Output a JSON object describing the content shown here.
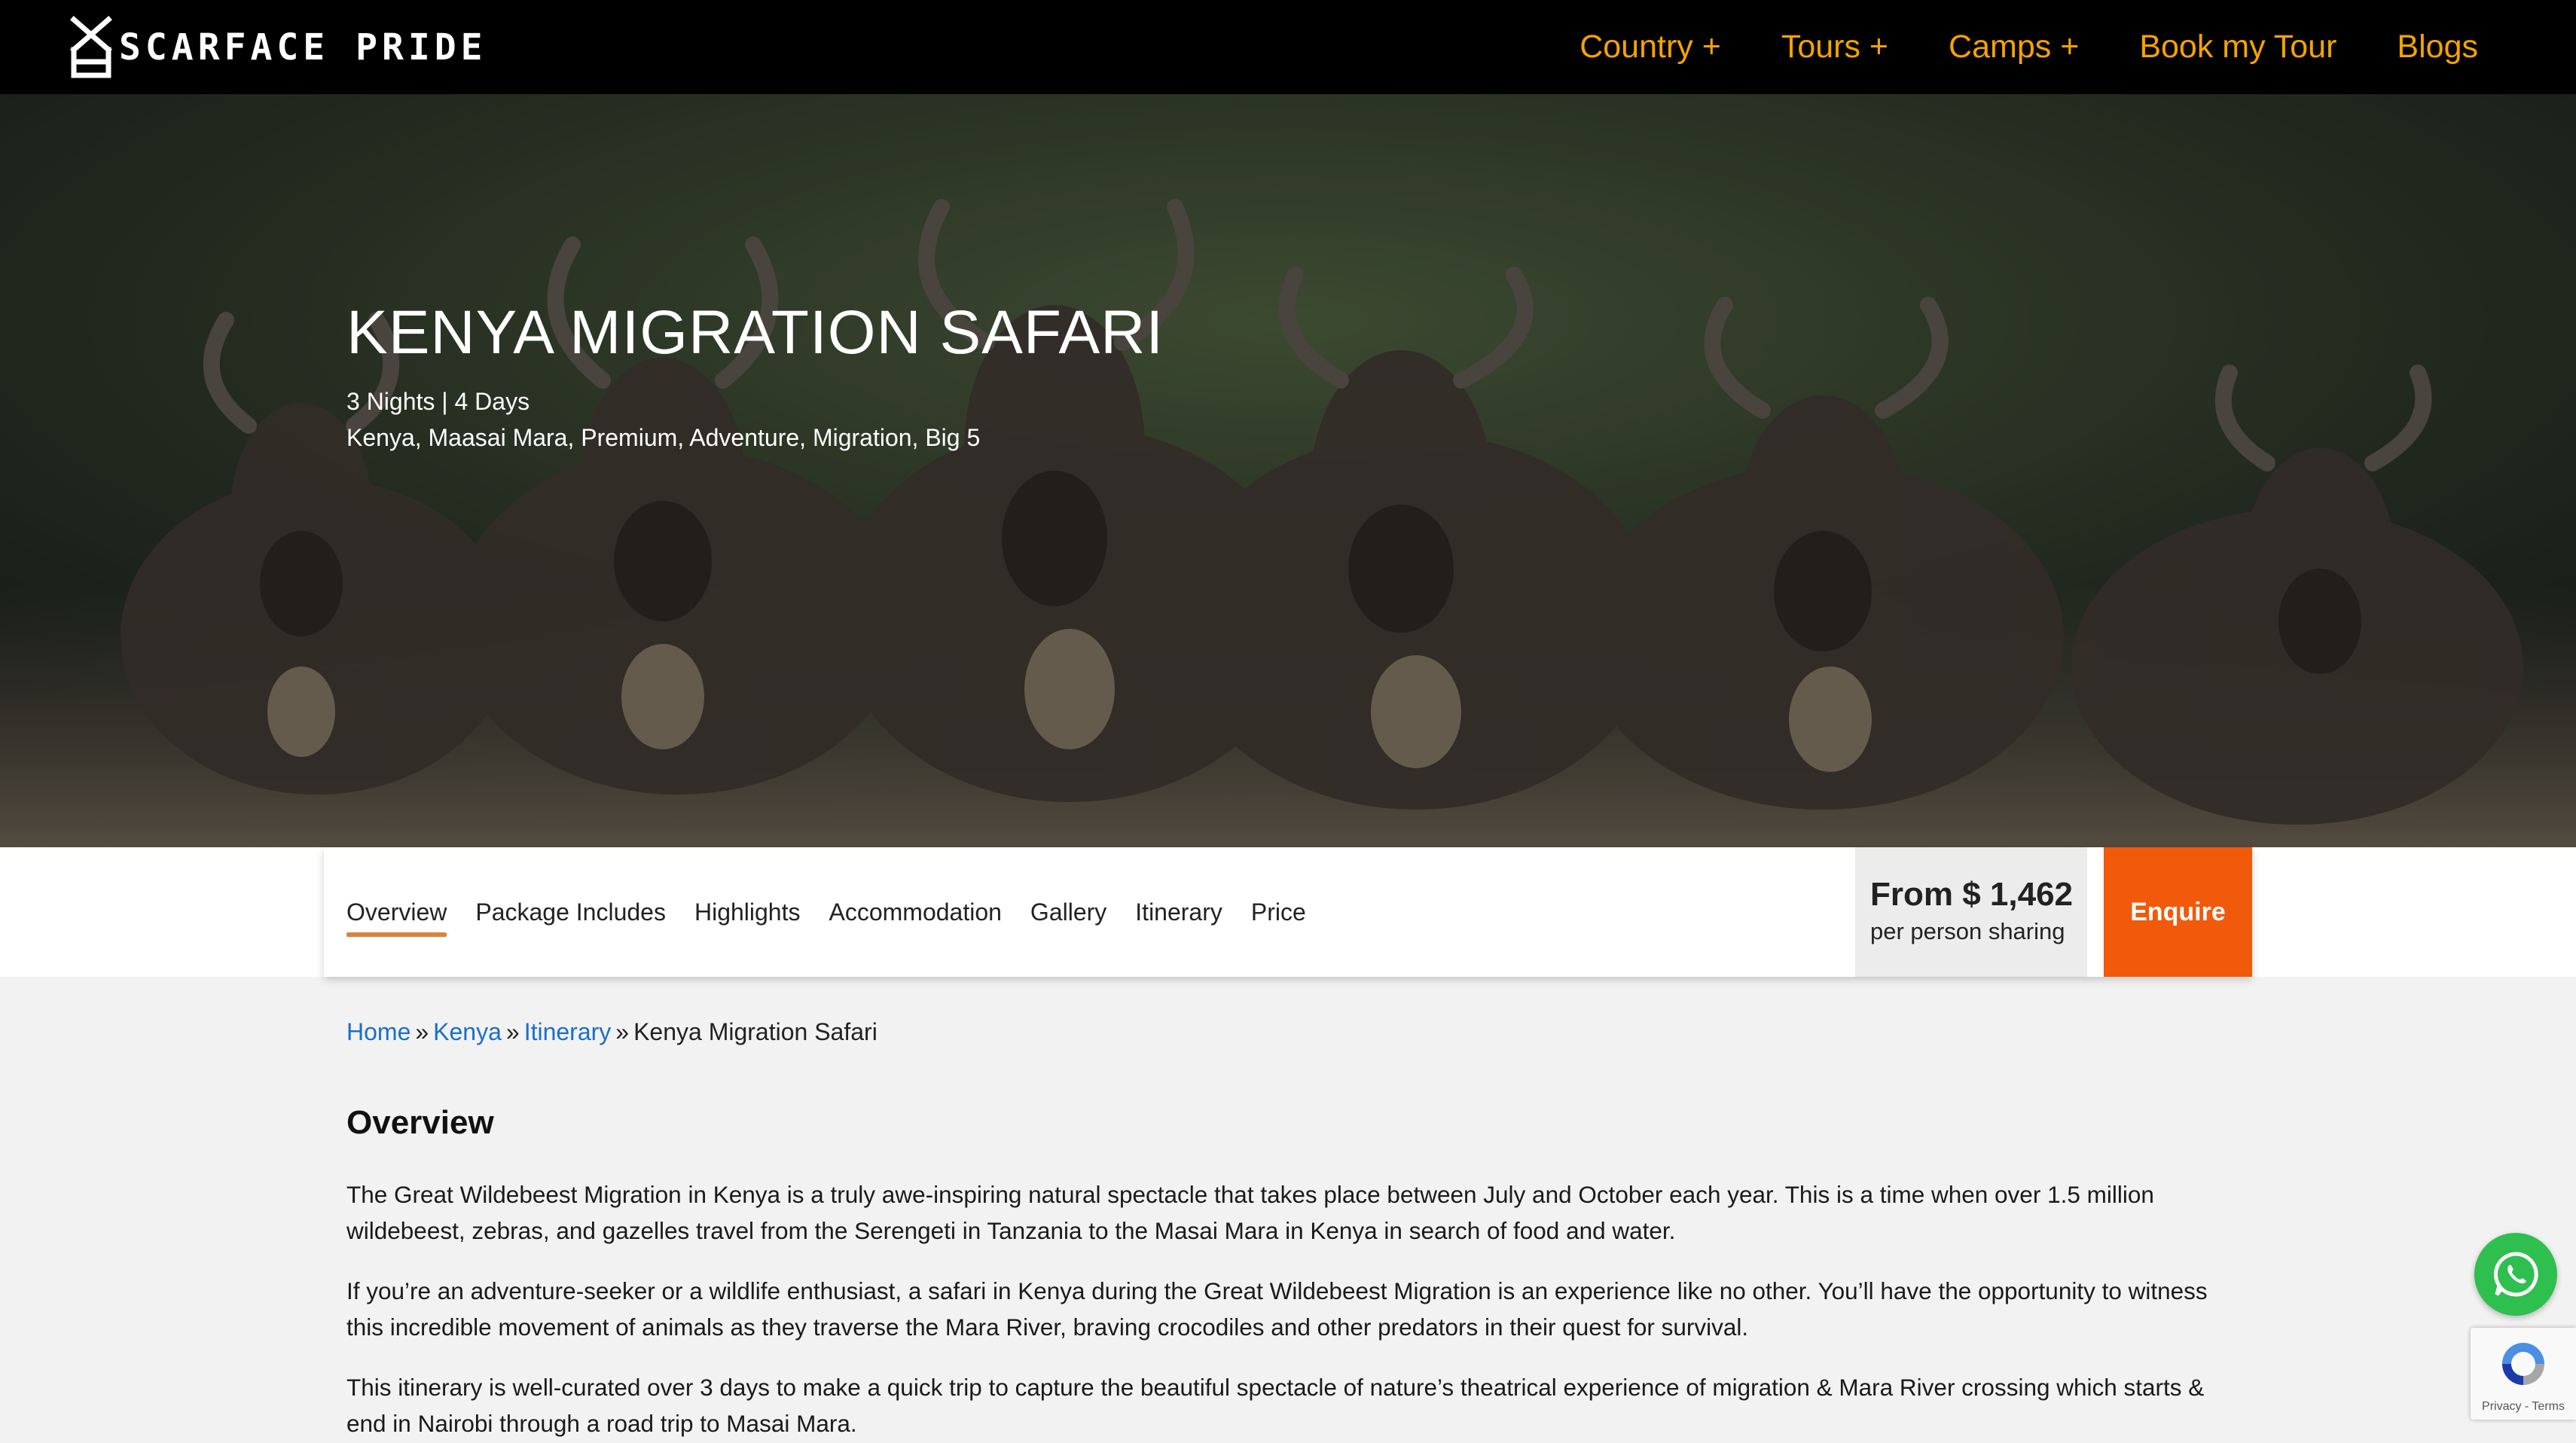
{
  "brand": {
    "name": "SCARFACE PRIDE"
  },
  "nav": {
    "items": [
      {
        "label": "Country +"
      },
      {
        "label": "Tours +"
      },
      {
        "label": "Camps +"
      },
      {
        "label": "Book my Tour"
      },
      {
        "label": "Blogs"
      }
    ]
  },
  "hero": {
    "title": "KENYA MIGRATION SAFARI",
    "duration": "3 Nights | 4 Days",
    "tags": "Kenya, Maasai Mara, Premium, Adventure, Migration, Big 5"
  },
  "tabs": [
    {
      "label": "Overview",
      "active": true
    },
    {
      "label": "Package Includes"
    },
    {
      "label": "Highlights"
    },
    {
      "label": "Accommodation"
    },
    {
      "label": "Gallery"
    },
    {
      "label": "Itinerary"
    },
    {
      "label": "Price"
    }
  ],
  "price": {
    "from": "From $ 1,462",
    "note": "per person sharing"
  },
  "enquire_label": "Enquire",
  "breadcrumb": {
    "home": "Home",
    "sep": "»",
    "country": "Kenya",
    "section": "Itinerary",
    "current": "Kenya Migration Safari"
  },
  "overview": {
    "title": "Overview",
    "paragraphs": [
      "The Great Wildebeest Migration in Kenya is a truly awe-inspiring natural spectacle that takes place between July and October each year. This is a time when over 1.5 million wildebeest, zebras, and gazelles travel from the Serengeti in Tanzania to the Masai Mara in Kenya in search of food and water.",
      "If you’re an adventure-seeker or a wildlife enthusiast, a safari in Kenya during the Great Wildebeest Migration is an experience like no other. You’ll have the opportunity to witness this incredible movement of animals as they traverse the Mara River, braving crocodiles and other predators in their quest for survival.",
      "This itinerary is well-curated over 3 days to make a quick trip to capture the beautiful spectacle of nature’s theatrical experience of migration & Mara River crossing which starts & end in Nairobi through a road trip to Masai Mara."
    ]
  },
  "recaptcha": {
    "links": "Privacy - Terms"
  },
  "colors": {
    "nav_accent": "#f5a300",
    "enquire_bg": "#f05a0a",
    "link": "#1a6fc9",
    "tab_underline": "#d9843a",
    "whatsapp": "#2fbf4f"
  },
  "icons": {
    "logo": "scarface-logo-icon",
    "whatsapp": "whatsapp-icon",
    "recaptcha": "recaptcha-icon"
  }
}
